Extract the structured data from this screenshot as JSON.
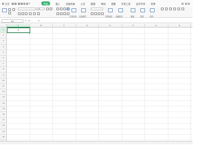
{
  "menubar": {
    "app_label": "文件",
    "tabs": [
      {
        "label": "开始",
        "active": true
      },
      {
        "label": "插入",
        "active": false
      },
      {
        "label": "页面布局",
        "active": false
      },
      {
        "label": "公式",
        "active": false
      },
      {
        "label": "数据",
        "active": false
      },
      {
        "label": "审阅",
        "active": false
      },
      {
        "label": "视图",
        "active": false
      },
      {
        "label": "开发工具",
        "active": false
      },
      {
        "label": "会员专享",
        "active": false
      },
      {
        "label": "效率",
        "active": false
      },
      {
        "label": "稻壳资源",
        "active": false
      }
    ]
  },
  "ribbon": {
    "font_size": "11",
    "labels": [
      "合并居中",
      "自动换行",
      "条件格式",
      "表格样式",
      "求和",
      "筛选",
      "排序"
    ]
  },
  "formula_bar": {
    "name_box": "A1",
    "value": "1"
  },
  "sheet": {
    "columns": [
      "A",
      "B",
      "C",
      "D",
      "E",
      "F",
      "G",
      "H"
    ],
    "rows": [
      "1",
      "2",
      "3",
      "4",
      "5",
      "6",
      "7",
      "8",
      "9",
      "10",
      "11",
      "12",
      "13",
      "14",
      "15",
      "16",
      "17",
      "18",
      "19",
      "20"
    ],
    "active_cell": {
      "ref": "A1",
      "value": "1"
    }
  },
  "colors": {
    "accent": "#3cb371",
    "selection": "#2e8b57"
  }
}
